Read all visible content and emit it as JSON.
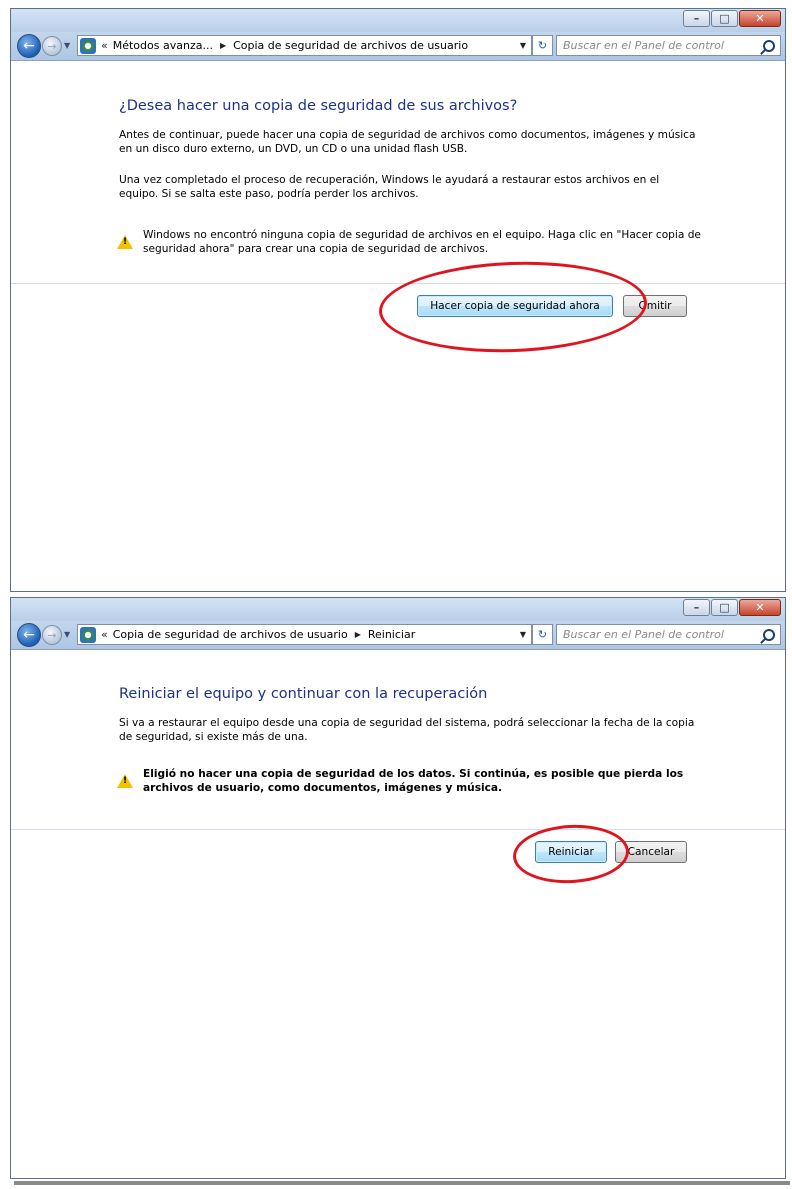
{
  "window1": {
    "controls": {
      "minimize": "–",
      "maximize": "□",
      "close": "✕"
    },
    "nav": {
      "back": "←",
      "forward": "→",
      "history": "▼"
    },
    "address": {
      "chevron": "«",
      "crumb1": "Métodos avanza...",
      "separator": "▶",
      "crumb2": "Copia de seguridad de archivos de usuario",
      "dropdown": "▼",
      "refresh": "↻"
    },
    "search": {
      "placeholder": "Buscar en el Panel de control"
    },
    "heading": "¿Desea hacer una copia de seguridad de sus archivos?",
    "para1": "Antes de continuar, puede hacer una copia de seguridad de archivos como documentos, imágenes y música en un disco duro externo, un DVD, un CD o una unidad flash USB.",
    "para2": "Una vez completado el proceso de recuperación, Windows le ayudará a restaurar estos archivos en el equipo. Si se salta este paso, podría perder los archivos.",
    "warning": "Windows no encontró ninguna copia de seguridad de archivos en el equipo. Haga clic en \"Hacer copia de seguridad ahora\" para crear una copia de seguridad de archivos.",
    "warning_glyph": "!",
    "buttons": {
      "backup_now": "Hacer copia de seguridad ahora",
      "skip": "Omitir"
    }
  },
  "window2": {
    "controls": {
      "minimize": "–",
      "maximize": "□",
      "close": "✕"
    },
    "nav": {
      "back": "←",
      "forward": "→",
      "history": "▼"
    },
    "address": {
      "chevron": "«",
      "crumb1": "Copia de seguridad de archivos de usuario",
      "separator": "▶",
      "crumb2": "Reiniciar",
      "dropdown": "▼",
      "refresh": "↻"
    },
    "search": {
      "placeholder": "Buscar en el Panel de control"
    },
    "heading": "Reiniciar el equipo y continuar con la recuperación",
    "para1": "Si va a restaurar el equipo desde una copia de seguridad del sistema, podrá seleccionar la fecha de la copia de seguridad, si existe más de una.",
    "warning": "Eligió no hacer una copia de seguridad de los datos. Si continúa, es posible que pierda los archivos de usuario, como documentos, imágenes y música.",
    "warning_glyph": "!",
    "buttons": {
      "restart": "Reiniciar",
      "cancel": "Cancelar"
    }
  },
  "colors": {
    "highlight": "#e0141e",
    "heading": "#1e3287",
    "warning": "#f2c200"
  }
}
